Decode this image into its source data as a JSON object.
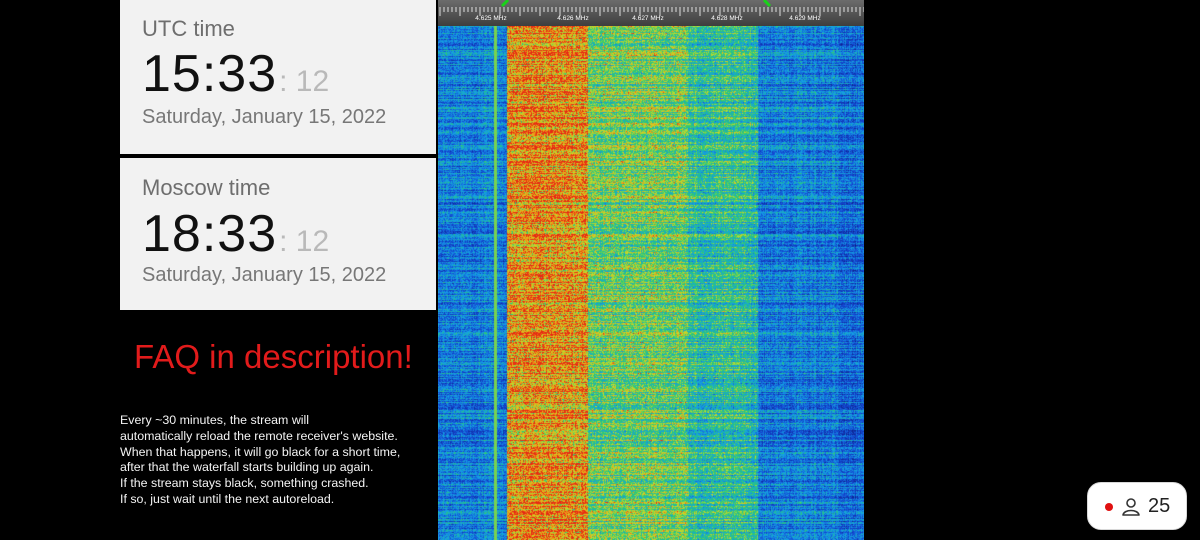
{
  "utc_clock": {
    "label": "UTC time",
    "hours_minutes": "15:33",
    "seconds": ": 12",
    "date": "Saturday, January 15, 2022"
  },
  "moscow_clock": {
    "label": "Moscow time",
    "hours_minutes": "18:33",
    "seconds": ": 12",
    "date": "Saturday, January 15, 2022"
  },
  "faq_heading": "FAQ in description!",
  "notice_lines": [
    "Every ~30 minutes, the stream will",
    "automatically reload the remote receiver's website.",
    "When that happens, it will go black for a short time,",
    "after that the waterfall starts building up again.",
    "If the stream stays black, something crashed.",
    "If so, just wait until the next autoreload."
  ],
  "waterfall": {
    "frequency_labels": [
      "4.625 MHz",
      "4.626 MHz",
      "4.627 MHz",
      "4.628 MHz",
      "4.629 MHz"
    ],
    "passband_color": "#19d219",
    "icon": "spectrum-waterfall"
  },
  "viewer_badge": {
    "count": "25",
    "live_color": "#e01010",
    "icon": "person-outline-icon"
  },
  "colors": {
    "background": "#000000",
    "clock_card": "#f2f2f2",
    "faq_red": "#e21b1b",
    "notice_text": "#f4f4f4"
  }
}
